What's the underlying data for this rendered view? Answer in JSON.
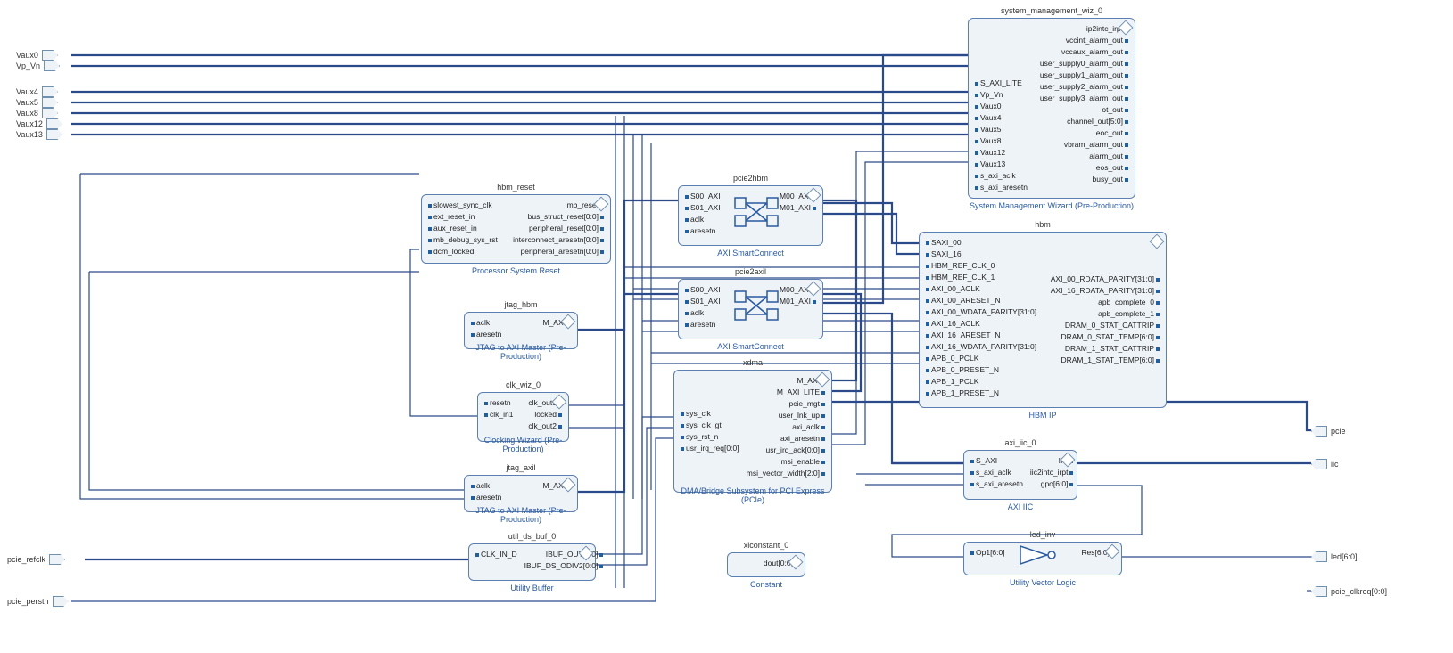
{
  "external_ports_left": {
    "vaux0": "Vaux0",
    "vpvn": "Vp_Vn",
    "vaux4": "Vaux4",
    "vaux5": "Vaux5",
    "vaux8": "Vaux8",
    "vaux12": "Vaux12",
    "vaux13": "Vaux13",
    "pcie_refclk": "pcie_refclk",
    "pcie_perstn": "pcie_perstn"
  },
  "external_ports_right": {
    "pcie": "pcie",
    "iic": "iic",
    "led": "led[6:0]",
    "pcie_clkreq": "pcie_clkreq[0:0]"
  },
  "blocks": {
    "hbm_reset": {
      "title": "hbm_reset",
      "subtitle": "Processor System Reset",
      "left": [
        "slowest_sync_clk",
        "ext_reset_in",
        "aux_reset_in",
        "mb_debug_sys_rst",
        "dcm_locked"
      ],
      "right": [
        "mb_reset",
        "bus_struct_reset[0:0]",
        "peripheral_reset[0:0]",
        "interconnect_aresetn[0:0]",
        "peripheral_aresetn[0:0]"
      ]
    },
    "jtag_hbm": {
      "title": "jtag_hbm",
      "subtitle": "JTAG to AXI Master (Pre-Production)",
      "left": [
        "aclk",
        "aresetn"
      ],
      "right": [
        "M_AXI"
      ]
    },
    "clk_wiz": {
      "title": "clk_wiz_0",
      "subtitle": "Clocking Wizard (Pre-Production)",
      "left": [
        "resetn",
        "clk_in1"
      ],
      "right": [
        "clk_out1",
        "locked",
        "clk_out2"
      ]
    },
    "jtag_axil": {
      "title": "jtag_axil",
      "subtitle": "JTAG to AXI Master (Pre-Production)",
      "left": [
        "aclk",
        "aresetn"
      ],
      "right": [
        "M_AXI"
      ]
    },
    "util_ds_buf": {
      "title": "util_ds_buf_0",
      "subtitle": "Utility Buffer",
      "left": [
        "CLK_IN_D"
      ],
      "right": [
        "IBUF_OUT[0:0]",
        "IBUF_DS_ODIV2[0:0]"
      ]
    },
    "pcie2hbm": {
      "title": "pcie2hbm",
      "subtitle": "AXI SmartConnect",
      "left": [
        "S00_AXI",
        "S01_AXI",
        "aclk",
        "aresetn"
      ],
      "right": [
        "M00_AXI",
        "M01_AXI"
      ]
    },
    "pcie2axil": {
      "title": "pcie2axil",
      "subtitle": "AXI SmartConnect",
      "left": [
        "S00_AXI",
        "S01_AXI",
        "aclk",
        "aresetn"
      ],
      "right": [
        "M00_AXI",
        "M01_AXI"
      ]
    },
    "xdma": {
      "title": "xdma",
      "subtitle": "DMA/Bridge Subsystem for PCI Express (PCIe)",
      "left": [
        "sys_clk",
        "sys_clk_gt",
        "sys_rst_n",
        "usr_irq_req[0:0]"
      ],
      "right": [
        "M_AXI",
        "M_AXI_LITE",
        "pcie_mgt",
        "user_lnk_up",
        "axi_aclk",
        "axi_aresetn",
        "usr_irq_ack[0:0]",
        "msi_enable",
        "msi_vector_width[2:0]"
      ]
    },
    "sysmgmt": {
      "title": "system_management_wiz_0",
      "subtitle": "System Management Wizard (Pre-Production)",
      "left": [
        "S_AXI_LITE",
        "Vp_Vn",
        "Vaux0",
        "Vaux4",
        "Vaux5",
        "Vaux8",
        "Vaux12",
        "Vaux13",
        "s_axi_aclk",
        "s_axi_aresetn"
      ],
      "right": [
        "ip2intc_irpt",
        "vccint_alarm_out",
        "vccaux_alarm_out",
        "user_supply0_alarm_out",
        "user_supply1_alarm_out",
        "user_supply2_alarm_out",
        "user_supply3_alarm_out",
        "ot_out",
        "channel_out[5:0]",
        "eoc_out",
        "vbram_alarm_out",
        "alarm_out",
        "eos_out",
        "busy_out"
      ]
    },
    "hbm": {
      "title": "hbm",
      "subtitle": "HBM IP",
      "left": [
        "SAXI_00",
        "SAXI_16",
        "HBM_REF_CLK_0",
        "HBM_REF_CLK_1",
        "AXI_00_ACLK",
        "AXI_00_ARESET_N",
        "AXI_00_WDATA_PARITY[31:0]",
        "AXI_16_ACLK",
        "AXI_16_ARESET_N",
        "AXI_16_WDATA_PARITY[31:0]",
        "APB_0_PCLK",
        "APB_0_PRESET_N",
        "APB_1_PCLK",
        "APB_1_PRESET_N"
      ],
      "right": [
        "AXI_00_RDATA_PARITY[31:0]",
        "AXI_16_RDATA_PARITY[31:0]",
        "apb_complete_0",
        "apb_complete_1",
        "DRAM_0_STAT_CATTRIP",
        "DRAM_0_STAT_TEMP[6:0]",
        "DRAM_1_STAT_CATTRIP",
        "DRAM_1_STAT_TEMP[6:0]"
      ]
    },
    "axi_iic": {
      "title": "axi_iic_0",
      "subtitle": "AXI IIC",
      "left": [
        "S_AXI",
        "s_axi_aclk",
        "s_axi_aresetn"
      ],
      "right": [
        "IIC",
        "iic2intc_irpt",
        "gpo[6:0]"
      ]
    },
    "led_inv": {
      "title": "led_inv",
      "subtitle": "Utility Vector Logic",
      "left": [
        "Op1[6:0]"
      ],
      "right": [
        "Res[6:0]"
      ]
    },
    "xlconstant": {
      "title": "xlconstant_0",
      "subtitle": "Constant",
      "right": [
        "dout[0:0]"
      ]
    }
  }
}
